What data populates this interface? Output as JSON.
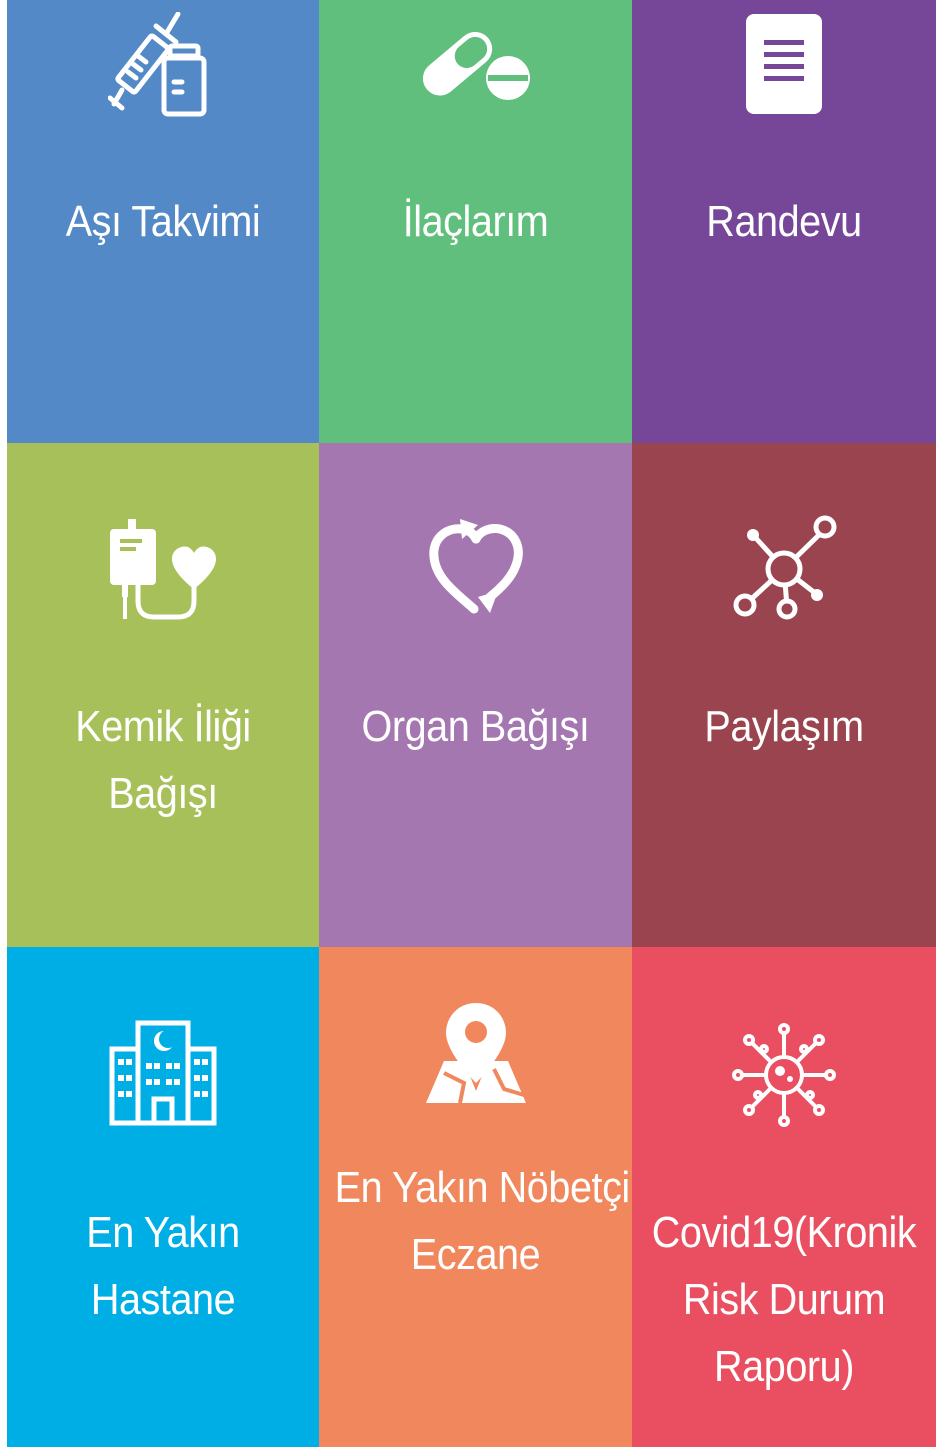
{
  "tiles": [
    {
      "id": "asi-takvimi",
      "label_lines": [
        "Aşı Takvimi"
      ],
      "color": "#5389C6",
      "icon": "vaccine-icon"
    },
    {
      "id": "ilaclarim",
      "label_lines": [
        "İlaçlarım"
      ],
      "color": "#60BF7C",
      "icon": "pills-icon"
    },
    {
      "id": "randevu",
      "label_lines": [
        "Randevu"
      ],
      "color": "#764698",
      "icon": "document-icon"
    },
    {
      "id": "kemik-iligi-bagisi",
      "label_lines": [
        "Kemik İliği",
        "Bağışı"
      ],
      "color": "#A8C05A",
      "icon": "blood-bag-heart-icon"
    },
    {
      "id": "organ-bagisi",
      "label_lines": [
        "Organ Bağışı"
      ],
      "color": "#A577B1",
      "icon": "heart-cycle-icon"
    },
    {
      "id": "paylasim",
      "label_lines": [
        "Paylaşım"
      ],
      "color": "#99444E",
      "icon": "network-share-icon"
    },
    {
      "id": "en-yakin-hastane",
      "label_lines": [
        "En Yakın",
        "Hastane"
      ],
      "color": "#00AEE6",
      "icon": "hospital-icon"
    },
    {
      "id": "en-yakin-nobetci-eczane",
      "label_lines": [
        "En Yakın Nöbetçi",
        "Eczane"
      ],
      "color": "#F1875C",
      "icon": "map-pin-icon"
    },
    {
      "id": "covid19-kronik-risk",
      "label_lines": [
        "Covid19(Kronik",
        "Risk Durum",
        "Raporu)"
      ],
      "color": "#EA4F61",
      "icon": "virus-icon"
    }
  ]
}
